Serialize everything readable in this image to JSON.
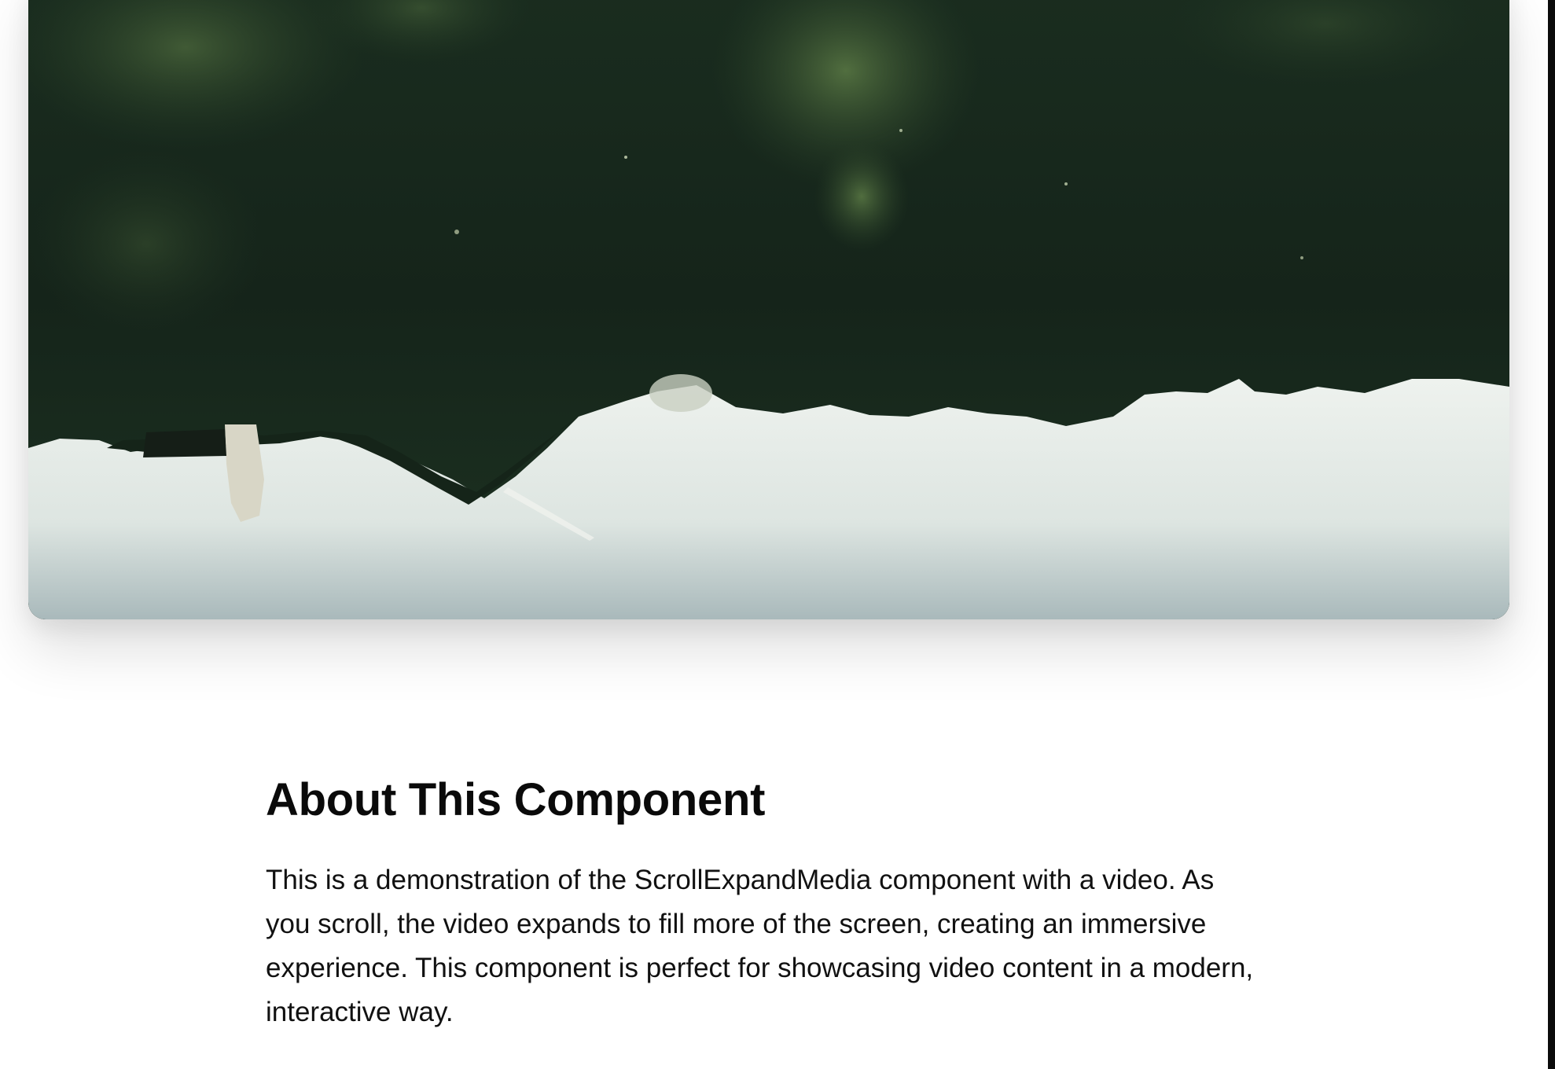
{
  "media": {
    "icon": "video-icon",
    "description_colors": {
      "sky": "#dfe6e2",
      "foliage_dark": "#16261b",
      "foliage_light": "#4a6a3a"
    }
  },
  "about": {
    "title": "About This Component",
    "body": "This is a demonstration of the ScrollExpandMedia component with a video. As you scroll, the video expands to fill more of the screen, creating an immersive experience. This component is perfect for showcasing video content in a modern, interactive way."
  }
}
